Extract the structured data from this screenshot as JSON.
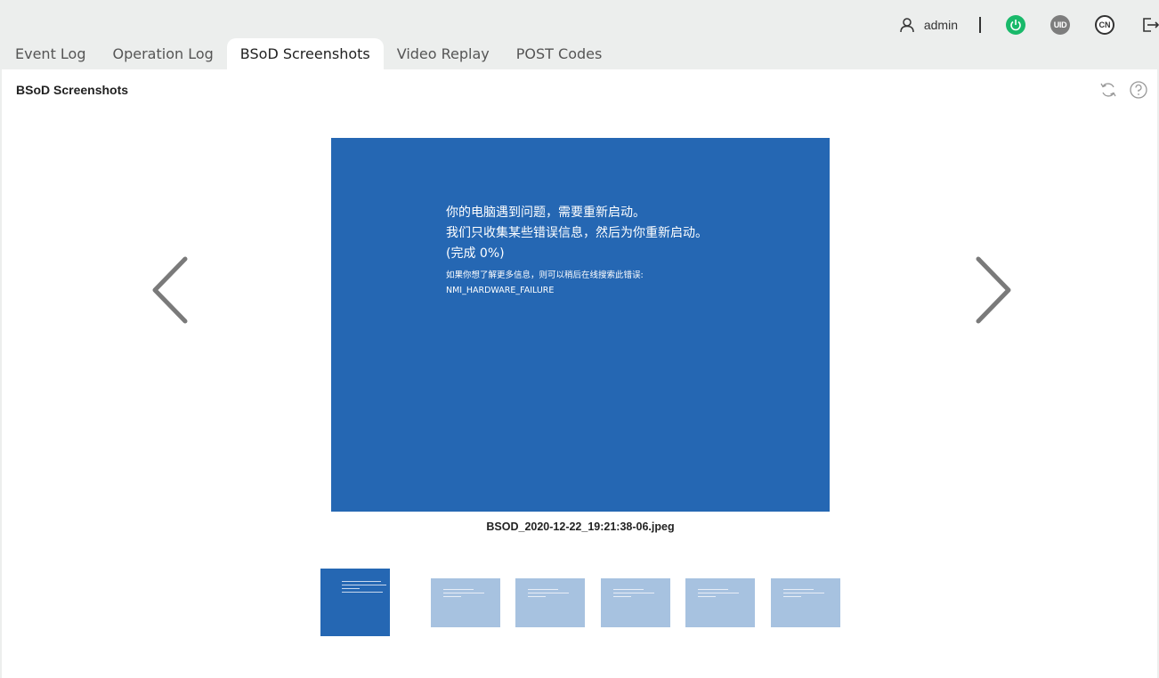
{
  "header": {
    "username": "admin",
    "uid_label": "UID",
    "lang_label": "CN"
  },
  "tabs": [
    {
      "label": "Event Log",
      "active": false
    },
    {
      "label": "Operation Log",
      "active": false
    },
    {
      "label": "BSoD Screenshots",
      "active": true
    },
    {
      "label": "Video Replay",
      "active": false
    },
    {
      "label": "POST Codes",
      "active": false
    }
  ],
  "panel": {
    "title": "BSoD Screenshots"
  },
  "viewer": {
    "bsod_lines": [
      "你的电脑遇到问题，需要重新启动。",
      "我们只收集某些错误信息，然后为你重新启动。",
      "(完成 0%)"
    ],
    "bsod_small_lines": [
      "如果你想了解更多信息，则可以稍后在线搜索此错误:",
      "NMI_HARDWARE_FAILURE"
    ],
    "filename": "BSOD_2020-12-22_19:21:38-06.jpeg",
    "thumbnail_count": 6,
    "selected_index": 0
  },
  "colors": {
    "bsod_blue": "#2567b3",
    "thumb_light": "#a7c2e0",
    "power_green": "#19b96a",
    "uid_gray": "#7d7d7d"
  }
}
